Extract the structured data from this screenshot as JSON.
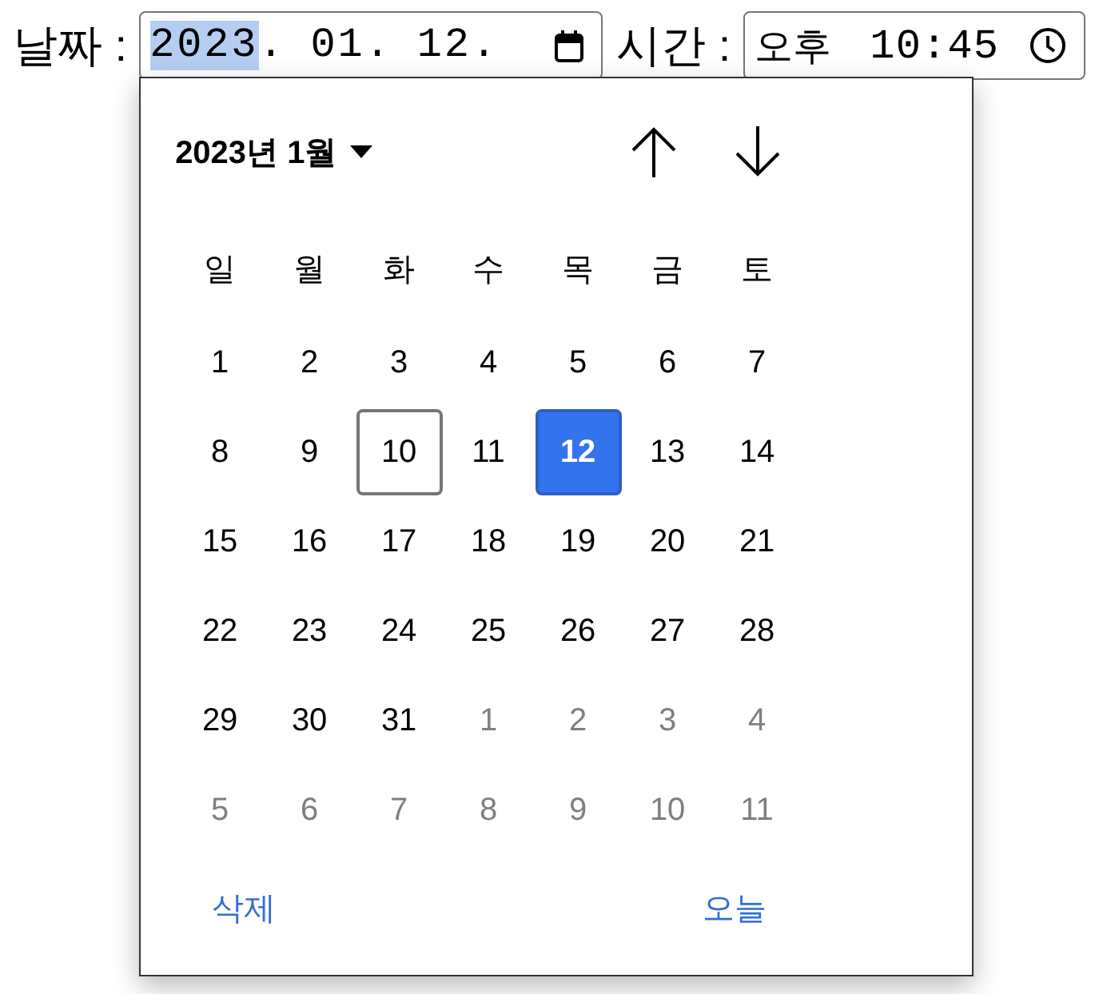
{
  "date_field": {
    "label": "날짜 :",
    "segments": [
      {
        "text": "2023",
        "separator": ".",
        "selected": true
      },
      {
        "text": "01",
        "separator": ".",
        "selected": false
      },
      {
        "text": "12",
        "separator": ".",
        "selected": false
      }
    ]
  },
  "time_field": {
    "label": "시간 :",
    "period": "오후",
    "value": "10:45"
  },
  "calendar": {
    "month_label": "2023년 1월",
    "weekdays": [
      "일",
      "월",
      "화",
      "수",
      "목",
      "금",
      "토"
    ],
    "days": [
      {
        "day": "1",
        "outside": false,
        "selected": false,
        "outlined": false
      },
      {
        "day": "2",
        "outside": false,
        "selected": false,
        "outlined": false
      },
      {
        "day": "3",
        "outside": false,
        "selected": false,
        "outlined": false
      },
      {
        "day": "4",
        "outside": false,
        "selected": false,
        "outlined": false
      },
      {
        "day": "5",
        "outside": false,
        "selected": false,
        "outlined": false
      },
      {
        "day": "6",
        "outside": false,
        "selected": false,
        "outlined": false
      },
      {
        "day": "7",
        "outside": false,
        "selected": false,
        "outlined": false
      },
      {
        "day": "8",
        "outside": false,
        "selected": false,
        "outlined": false
      },
      {
        "day": "9",
        "outside": false,
        "selected": false,
        "outlined": false
      },
      {
        "day": "10",
        "outside": false,
        "selected": false,
        "outlined": true
      },
      {
        "day": "11",
        "outside": false,
        "selected": false,
        "outlined": false
      },
      {
        "day": "12",
        "outside": false,
        "selected": true,
        "outlined": false
      },
      {
        "day": "13",
        "outside": false,
        "selected": false,
        "outlined": false
      },
      {
        "day": "14",
        "outside": false,
        "selected": false,
        "outlined": false
      },
      {
        "day": "15",
        "outside": false,
        "selected": false,
        "outlined": false
      },
      {
        "day": "16",
        "outside": false,
        "selected": false,
        "outlined": false
      },
      {
        "day": "17",
        "outside": false,
        "selected": false,
        "outlined": false
      },
      {
        "day": "18",
        "outside": false,
        "selected": false,
        "outlined": false
      },
      {
        "day": "19",
        "outside": false,
        "selected": false,
        "outlined": false
      },
      {
        "day": "20",
        "outside": false,
        "selected": false,
        "outlined": false
      },
      {
        "day": "21",
        "outside": false,
        "selected": false,
        "outlined": false
      },
      {
        "day": "22",
        "outside": false,
        "selected": false,
        "outlined": false
      },
      {
        "day": "23",
        "outside": false,
        "selected": false,
        "outlined": false
      },
      {
        "day": "24",
        "outside": false,
        "selected": false,
        "outlined": false
      },
      {
        "day": "25",
        "outside": false,
        "selected": false,
        "outlined": false
      },
      {
        "day": "26",
        "outside": false,
        "selected": false,
        "outlined": false
      },
      {
        "day": "27",
        "outside": false,
        "selected": false,
        "outlined": false
      },
      {
        "day": "28",
        "outside": false,
        "selected": false,
        "outlined": false
      },
      {
        "day": "29",
        "outside": false,
        "selected": false,
        "outlined": false
      },
      {
        "day": "30",
        "outside": false,
        "selected": false,
        "outlined": false
      },
      {
        "day": "31",
        "outside": false,
        "selected": false,
        "outlined": false
      },
      {
        "day": "1",
        "outside": true,
        "selected": false,
        "outlined": false
      },
      {
        "day": "2",
        "outside": true,
        "selected": false,
        "outlined": false
      },
      {
        "day": "3",
        "outside": true,
        "selected": false,
        "outlined": false
      },
      {
        "day": "4",
        "outside": true,
        "selected": false,
        "outlined": false
      },
      {
        "day": "5",
        "outside": true,
        "selected": false,
        "outlined": false
      },
      {
        "day": "6",
        "outside": true,
        "selected": false,
        "outlined": false
      },
      {
        "day": "7",
        "outside": true,
        "selected": false,
        "outlined": false
      },
      {
        "day": "8",
        "outside": true,
        "selected": false,
        "outlined": false
      },
      {
        "day": "9",
        "outside": true,
        "selected": false,
        "outlined": false
      },
      {
        "day": "10",
        "outside": true,
        "selected": false,
        "outlined": false
      },
      {
        "day": "11",
        "outside": true,
        "selected": false,
        "outlined": false
      }
    ],
    "actions": [
      {
        "label": "삭제"
      },
      {
        "label": "오늘"
      }
    ]
  }
}
